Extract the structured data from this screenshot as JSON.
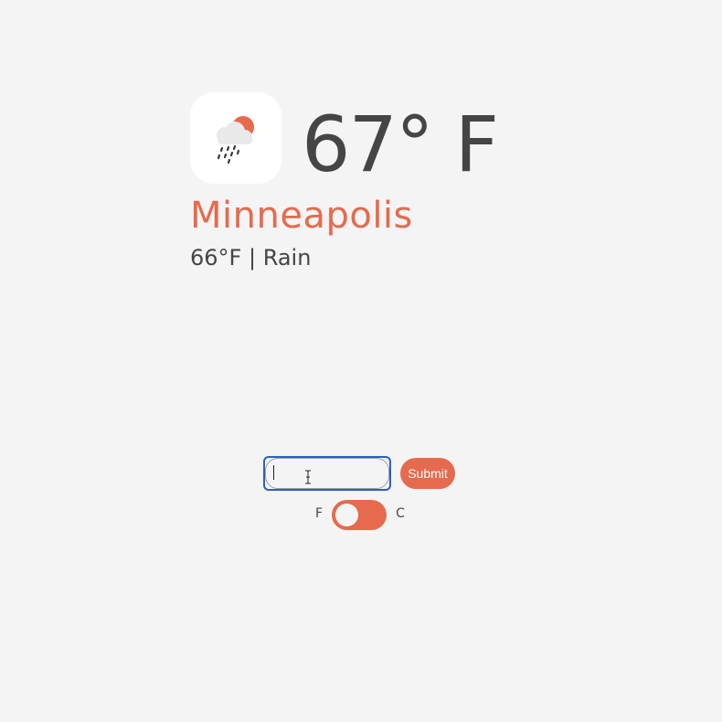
{
  "weather": {
    "icon": "rain-cloud-sun-icon",
    "temperature": "67° F",
    "city": "Minneapolis",
    "conditions": "66°F | Rain"
  },
  "form": {
    "city_input_value": "",
    "submit_label": "Submit"
  },
  "units": {
    "left_label": "F",
    "right_label": "C",
    "selected": "F"
  },
  "colors": {
    "accent": "#e66a4d",
    "text": "#454545",
    "background": "#f4f4f4",
    "input_focus": "#2c5ec9"
  }
}
